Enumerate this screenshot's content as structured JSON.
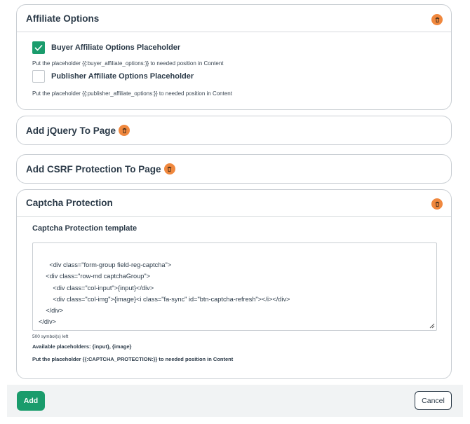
{
  "colors": {
    "accent": "#1a9c6c",
    "delete": "#f0883e",
    "text": "#2b3a48",
    "border": "#c9ced3"
  },
  "affiliate": {
    "title": "Affiliate Options",
    "options": [
      {
        "label": "Buyer Affiliate Options Placeholder",
        "checked": true,
        "hint": "Put the placeholder {{:buyer_affiliate_options:}} to needed position in Content"
      },
      {
        "label": "Publisher Affiliate Options Placeholder",
        "checked": false,
        "hint": "Put the placeholder {{:publisher_affiliate_options:}} to needed position in Content"
      }
    ]
  },
  "jquery": {
    "title": "Add jQuery To Page"
  },
  "csrf": {
    "title": "Add CSRF Protection To Page"
  },
  "captcha": {
    "title": "Captcha Protection",
    "field_label": "Captcha Protection template",
    "template": "<div class=\"form-group field-reg-captcha\">\n    <div class=\"row-md captchaGroup\">\n        <div class=\"col-input\">{input}</div>\n        <div class=\"col-img\">{image}<i class=\"fa-sync\" id=\"btn-captcha-refresh\"></i></div>\n    </div>\n</div>",
    "symbols_left": "500 symbol(s) left",
    "available": "Available placeholders: {input}, {image}",
    "hint": "Put the placeholder {{:CAPTCHA_PROTECTION:}} to needed position in Content"
  },
  "footer": {
    "add_label": "Add",
    "cancel_label": "Cancel"
  },
  "icons": {
    "delete": "trash-icon",
    "check": "check-icon",
    "resize": "resize-grip-icon"
  }
}
